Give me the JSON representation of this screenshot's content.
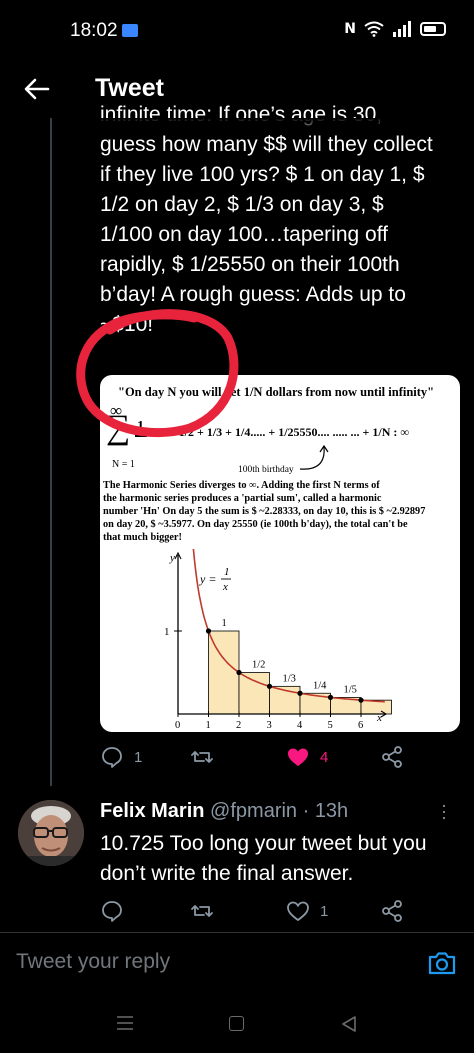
{
  "status_bar": {
    "time": "18:02"
  },
  "header": {
    "title": "Tweet"
  },
  "tweet": {
    "text": "infinite time: If one’s age is 30,\nguess how many $$ will they collect\nif they live 100 yrs? $ 1 on day 1, $\n1/2 on day 2, $ 1/3 on day 3, $\n1/100 on day 100…tapering off\nrapidly, $ 1/25550 on their 100th\nb’day! A rough guess: Adds up to\n~$10!",
    "image": {
      "quote": "\"On day N you will get 1/N dollars from now until infinity\"",
      "infinity": "∞",
      "sigma": "∑",
      "frac_num": "1",
      "sum": "= 1 + 1/2 + 1/3 + 1/4..... + 1/25550.... ..... ... + 1/N :  ∞",
      "n_label": "N = 1",
      "bday_label": "100th birthday",
      "body": "The Harmonic Series  diverges  to ∞.  Adding the first N terms of\nthe harmonic series produces a 'partial sum',  called a harmonic\nnumber 'Hn'  On day 5 the sum is $ ~2.28333, on day 10, this is $ ~2.92897\non day 20, $ ~3.5977.  On day 25550 (ie 100th b'day), the total can't be\nthat much bigger!",
      "plot": {
        "y_axis": "y",
        "x_axis": "x",
        "equation_lhs": "y =",
        "equation_num": "1",
        "equation_den": "x",
        "y_tick": "1",
        "x_ticks": [
          "0",
          "1",
          "2",
          "3",
          "4",
          "5",
          "6"
        ],
        "bar_labels": [
          "1",
          "1/2",
          "1/3",
          "1/4",
          "1/5"
        ],
        "curve_color": "#c0392b",
        "bar_fill": "#fbe6b8"
      }
    },
    "actions": {
      "replies": "1",
      "retweets": "",
      "likes": "4",
      "like_color": "#f91880"
    }
  },
  "reply": {
    "name": "Felix Marin",
    "handle": "@fpmarin · 13h",
    "text": "10.725 Too long your tweet but you don’t write the final answer.",
    "actions": {
      "replies": "",
      "retweets": "",
      "likes": "1"
    }
  },
  "compose": {
    "placeholder": "Tweet your reply"
  },
  "colors": {
    "background": "#000000",
    "text": "#e7e9ea",
    "muted": "#8b98a5",
    "accent": "#1d9bf0",
    "annotation": "#e8243c"
  }
}
